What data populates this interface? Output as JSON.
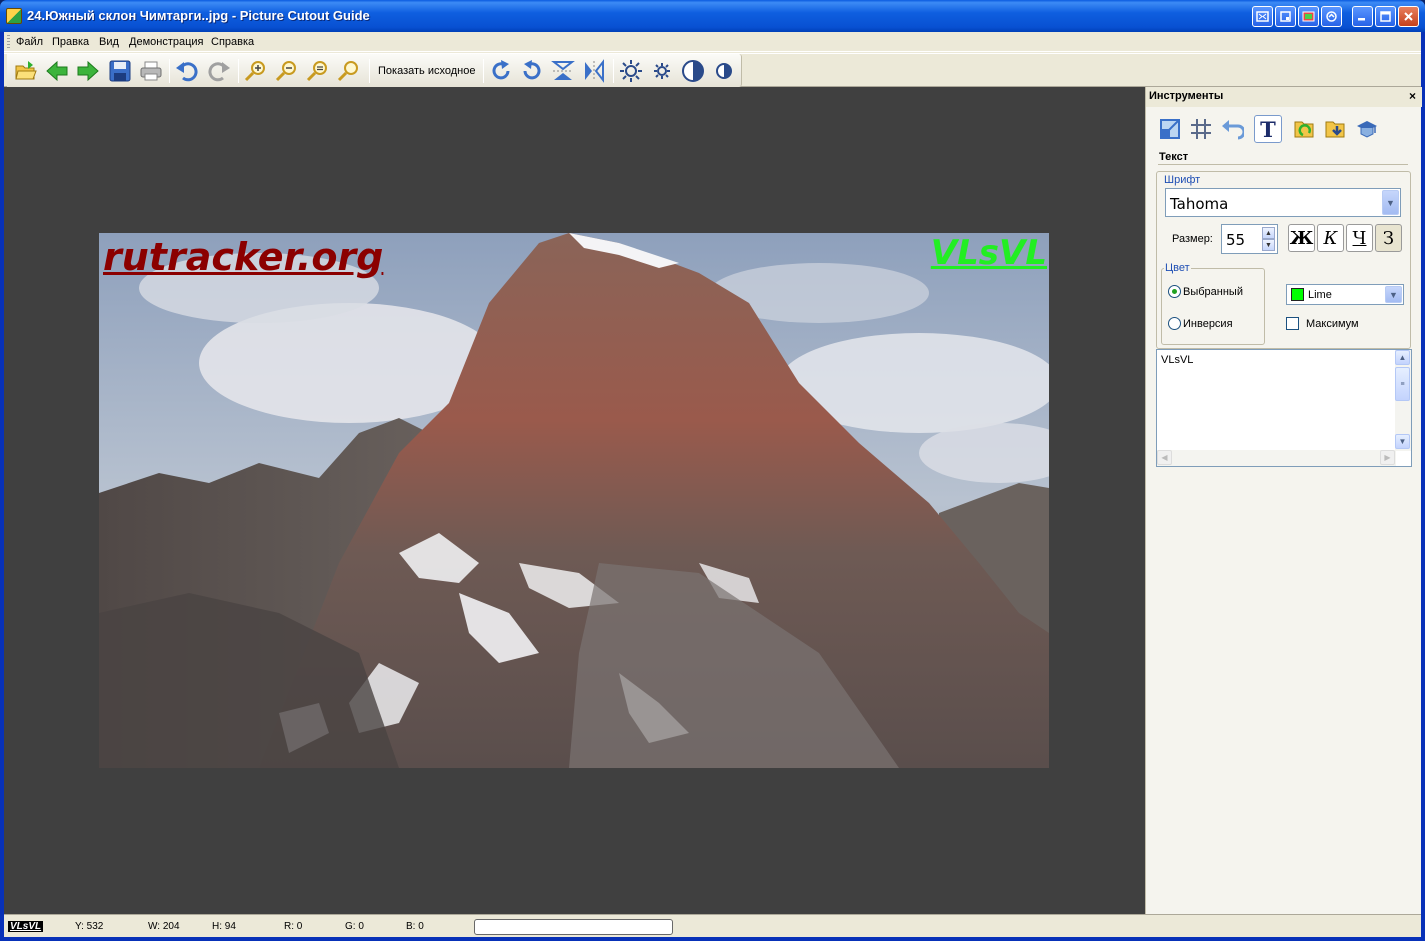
{
  "window": {
    "title": "24.Южный склон Чимтарги..jpg - Picture Cutout Guide",
    "controls": [
      "minimize",
      "maximize",
      "close"
    ]
  },
  "menu": {
    "items": [
      "Файл",
      "Правка",
      "Вид",
      "Демонстрация",
      "Справка"
    ]
  },
  "toolbar": {
    "show_original_label": "Показать исходное",
    "icons": [
      "open-icon",
      "back-icon",
      "forward-icon",
      "save-icon",
      "print-icon",
      "undo-icon",
      "redo-icon",
      "zoom-in-icon",
      "zoom-out-icon",
      "zoom-fit-icon",
      "zoom-actual-icon",
      "rotate-cw-icon",
      "rotate-ccw-icon",
      "flip-vertical-icon",
      "flip-horizontal-icon",
      "brightness-up-icon",
      "brightness-down-icon",
      "contrast-up-icon",
      "contrast-down-icon"
    ]
  },
  "photo": {
    "watermark_left": "rutracker.org",
    "watermark_right": "VLsVL"
  },
  "panel": {
    "title": "Инструменты",
    "close": "×",
    "section_title": "Текст",
    "font": {
      "group_label": "Шрифт",
      "value": "Tahoma"
    },
    "size": {
      "label": "Размер:",
      "value": "55"
    },
    "style_buttons": {
      "bold": "Ж",
      "italic": "К",
      "underline": "Ч",
      "strike": "З"
    },
    "color": {
      "group_label": "Цвет",
      "option_selected": "Выбранный",
      "option_inverse": "Инверсия",
      "selected_option": "Выбранный",
      "value": "Lime",
      "swatch": "#00ff00",
      "max_label": "Максимум",
      "max_checked": false
    },
    "text_value": "VLsVL"
  },
  "status": {
    "logo": "VLsVL",
    "y": "Y: 532",
    "w": "W: 204",
    "h": "H: 94",
    "r": "R: 0",
    "g": "G: 0",
    "b": "B: 0"
  },
  "colors": {
    "titlebar": "#0a5be0",
    "canvas_bg": "#404040",
    "watermark_left": "#8b0000",
    "watermark_right": "#22ee22"
  }
}
